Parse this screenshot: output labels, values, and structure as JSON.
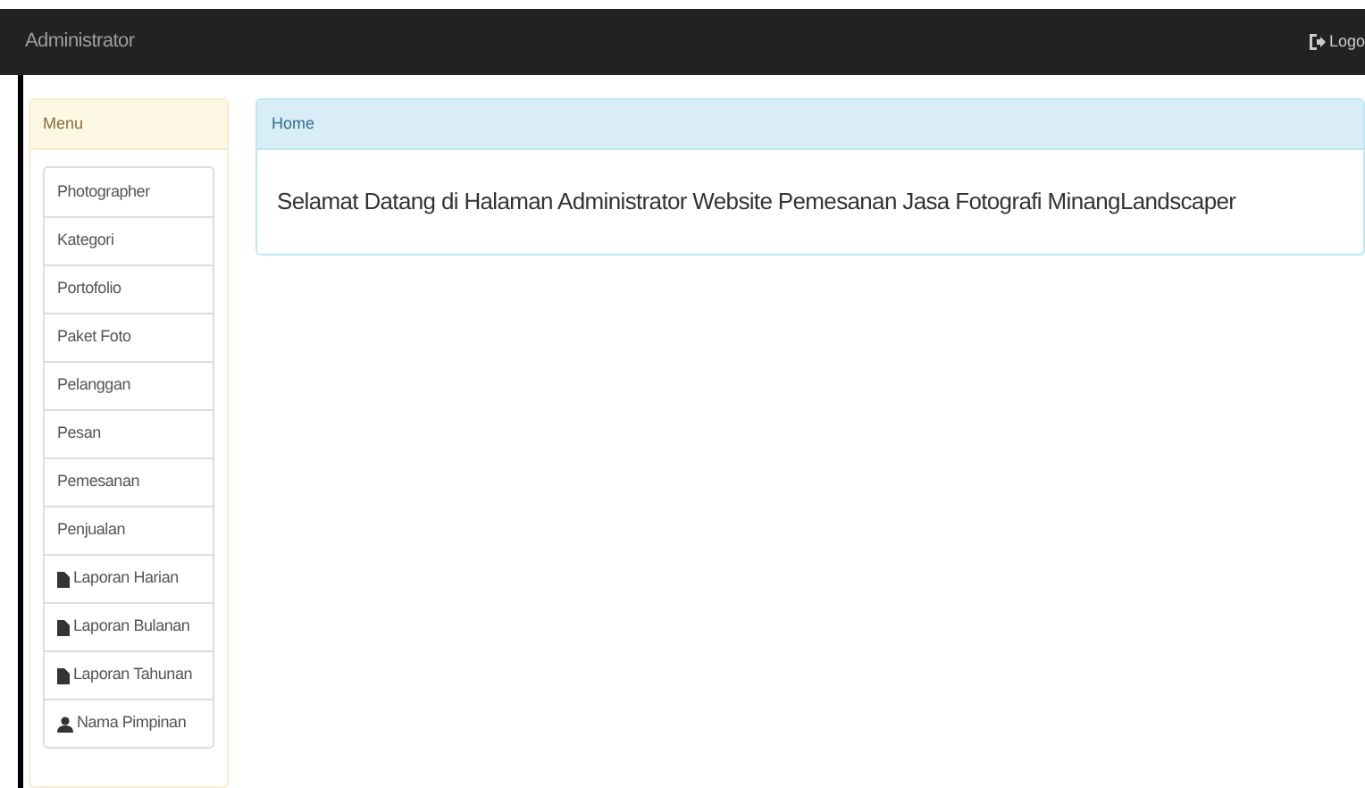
{
  "navbar": {
    "brand": "Administrator",
    "logout": "Logo"
  },
  "sidebar": {
    "title": "Menu",
    "items": [
      {
        "label": "Photographer",
        "kind": "plain"
      },
      {
        "label": "Kategori",
        "kind": "plain"
      },
      {
        "label": "Portofolio",
        "kind": "plain"
      },
      {
        "label": "Paket Foto",
        "kind": "plain"
      },
      {
        "label": "Pelanggan",
        "kind": "plain"
      },
      {
        "label": "Pesan",
        "kind": "plain"
      },
      {
        "label": "Pemesanan",
        "kind": "plain"
      },
      {
        "label": "Penjualan",
        "kind": "plain"
      },
      {
        "label": "Laporan Harian",
        "kind": "file"
      },
      {
        "label": "Laporan Bulanan",
        "kind": "file"
      },
      {
        "label": "Laporan Tahunan",
        "kind": "file"
      },
      {
        "label": "Nama Pimpinan",
        "kind": "user"
      }
    ]
  },
  "main": {
    "breadcrumb": "Home",
    "welcome": "Selamat Datang di Halaman Administrator Website Pemesanan Jasa Fotografi MinangLandscaper"
  }
}
